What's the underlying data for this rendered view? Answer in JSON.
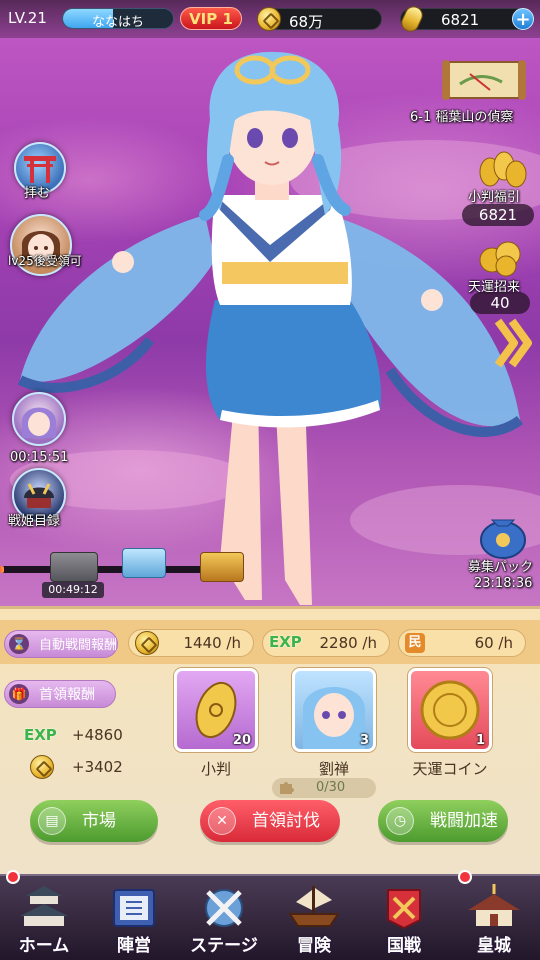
{
  "player": {
    "level": "LV.21",
    "name": "ななはち",
    "exp_fraction": 0.45,
    "vip": "VIP 1"
  },
  "resources": {
    "silver": "68万",
    "gold": "6821"
  },
  "left_side": {
    "pray_label": "拝む",
    "lv25_label": "lv25後受領可",
    "timer_1": "00:15:51",
    "catalog_label": "戦姫目録"
  },
  "right_side": {
    "stage_label": "6-1 稲葉山の偵察",
    "koban_lucky_label": "小判福引",
    "koban_lucky_count": "6821",
    "fortune_label": "天運招来",
    "fortune_count": "40",
    "recruit_label": "募集パック",
    "recruit_timer": "23:18:36"
  },
  "chest_strip": {
    "timer": "00:49:12",
    "progress_fraction": 0.02
  },
  "panel": {
    "auto_reward_label": "自動戦闘報酬",
    "rates": [
      {
        "icon": "silver-coin-icon",
        "value": "1440 /h"
      },
      {
        "icon": "exp-icon",
        "badge": "EXP",
        "value": "2280 /h"
      },
      {
        "icon": "citizen-icon",
        "badge": "民",
        "value": "60 /h"
      }
    ],
    "boss_reward_label": "首領報酬",
    "boss_exp_badge": "EXP",
    "boss_exp": "+4860",
    "boss_silver": "+3402",
    "items": [
      {
        "name": "小判",
        "count": "20"
      },
      {
        "name": "劉禅",
        "count": "3"
      },
      {
        "name": "天運コイン",
        "count": "1"
      }
    ],
    "fragment_progress": "0/30",
    "buttons": {
      "market": "市場",
      "boss_battle": "首領討伐",
      "speed_up": "戦闘加速"
    }
  },
  "nav": [
    {
      "label": "ホーム"
    },
    {
      "label": "陣営"
    },
    {
      "label": "ステージ"
    },
    {
      "label": "冒険"
    },
    {
      "label": "国戦"
    },
    {
      "label": "皇城"
    }
  ],
  "colors": {
    "accent_red": "#d92a38",
    "accent_green": "#4d9b2f",
    "panel_bg": "#f2e3c2",
    "bg_purple": "#a843b6"
  }
}
